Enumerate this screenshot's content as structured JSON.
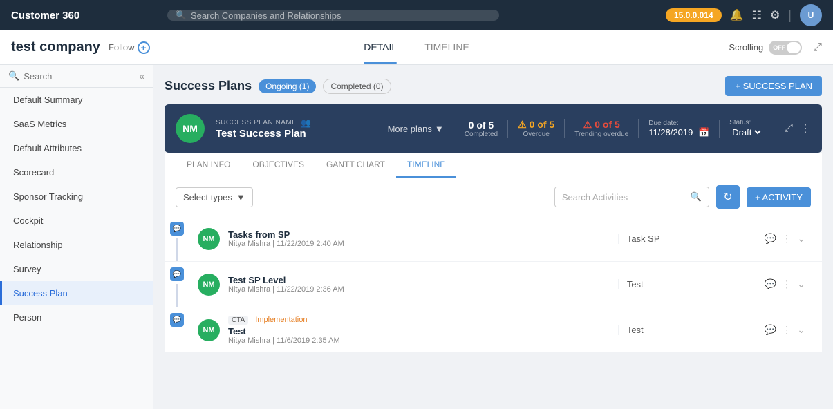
{
  "app": {
    "title": "Customer 360",
    "search_placeholder": "Search Companies and Relationships",
    "version": "15.0.0.014"
  },
  "company": {
    "name": "test company",
    "follow_label": "Follow"
  },
  "tabs": {
    "detail": "DETAIL",
    "timeline": "TIMELINE"
  },
  "scrolling": {
    "label": "Scrolling",
    "toggle_label": "OFF"
  },
  "sidebar": {
    "search_placeholder": "Search",
    "items": [
      {
        "label": "Default Summary",
        "active": false
      },
      {
        "label": "SaaS Metrics",
        "active": false
      },
      {
        "label": "Default Attributes",
        "active": false
      },
      {
        "label": "Scorecard",
        "active": false
      },
      {
        "label": "Sponsor Tracking",
        "active": false
      },
      {
        "label": "Cockpit",
        "active": false
      },
      {
        "label": "Relationship",
        "active": false
      },
      {
        "label": "Survey",
        "active": false
      },
      {
        "label": "Success Plan",
        "active": true
      },
      {
        "label": "Person",
        "active": false
      }
    ]
  },
  "success_plans": {
    "title": "Success Plans",
    "ongoing_label": "Ongoing (1)",
    "completed_label": "Completed (0)",
    "add_button": "+ SUCCESS PLAN"
  },
  "plan": {
    "avatar_initials": "NM",
    "label": "SUCCESS PLAN NAME",
    "name": "Test Success Plan",
    "more_plans": "More plans",
    "stats": {
      "completed": {
        "value": "0 of 5",
        "label": "Completed"
      },
      "overdue": {
        "value": "0 of 5",
        "label": "Overdue"
      },
      "trending": {
        "value": "0 of 5",
        "label": "Trending overdue"
      }
    },
    "due_date_label": "Due date:",
    "due_date_value": "11/28/2019",
    "status_label": "Status:",
    "status_value": "Draft"
  },
  "plan_tabs": [
    {
      "label": "PLAN INFO",
      "active": false
    },
    {
      "label": "OBJECTIVES",
      "active": false
    },
    {
      "label": "GANTT CHART",
      "active": false
    },
    {
      "label": "TIMELINE",
      "active": true
    }
  ],
  "timeline": {
    "select_types_placeholder": "Select types",
    "search_activities_placeholder": "Search Activities",
    "add_activity_label": "+ ACTIVITY",
    "items": [
      {
        "avatar": "NM",
        "title": "Tasks from SP",
        "meta": "Nitya Mishra | 11/22/2019 2:40 AM",
        "description": "Task SP",
        "cta_badge": "",
        "impl_badge": ""
      },
      {
        "avatar": "NM",
        "title": "Test SP Level",
        "meta": "Nitya Mishra | 11/22/2019 2:36 AM",
        "description": "Test",
        "cta_badge": "",
        "impl_badge": ""
      },
      {
        "avatar": "NM",
        "title": "Test",
        "meta": "Nitya Mishra | 11/6/2019 2:35 AM",
        "description": "Test",
        "cta_badge": "CTA",
        "impl_badge": "Implementation"
      }
    ]
  }
}
